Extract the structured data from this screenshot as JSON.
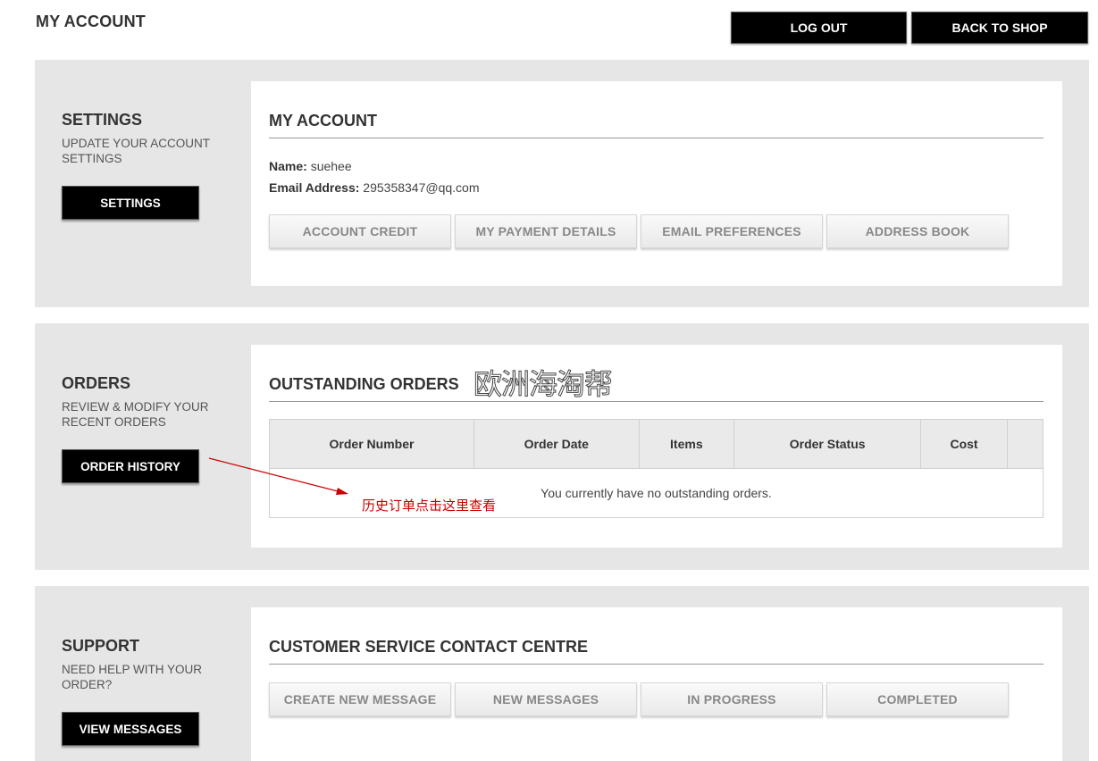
{
  "header": {
    "title": "MY ACCOUNT",
    "logout_label": "LOG OUT",
    "back_label": "BACK TO SHOP"
  },
  "settings": {
    "title": "SETTINGS",
    "description": "UPDATE YOUR ACCOUNT SETTINGS",
    "button_label": "SETTINGS"
  },
  "account": {
    "title": "MY ACCOUNT",
    "name_label": "Name:",
    "name_value": "suehee",
    "email_label": "Email Address:",
    "email_value": "295358347@qq.com",
    "buttons": [
      "ACCOUNT CREDIT",
      "MY PAYMENT DETAILS",
      "EMAIL PREFERENCES",
      "ADDRESS BOOK"
    ]
  },
  "orders": {
    "title": "ORDERS",
    "description": "REVIEW & MODIFY YOUR RECENT ORDERS",
    "button_label": "ORDER HISTORY",
    "panel_title": "OUTSTANDING ORDERS",
    "columns": [
      "Order Number",
      "Order Date",
      "Items",
      "Order Status",
      "Cost",
      ""
    ],
    "empty_message": "You currently have no outstanding orders."
  },
  "support": {
    "title": "SUPPORT",
    "description": "NEED HELP WITH YOUR ORDER?",
    "button_label": "VIEW MESSAGES",
    "panel_title": "CUSTOMER SERVICE CONTACT CENTRE",
    "buttons": [
      "CREATE NEW MESSAGE",
      "NEW MESSAGES",
      "IN PROGRESS",
      "COMPLETED"
    ]
  },
  "annotations": {
    "watermark": "欧洲海淘帮",
    "arrow_note": "历史订单点击这里查看",
    "arrow_color": "#cc0000"
  }
}
